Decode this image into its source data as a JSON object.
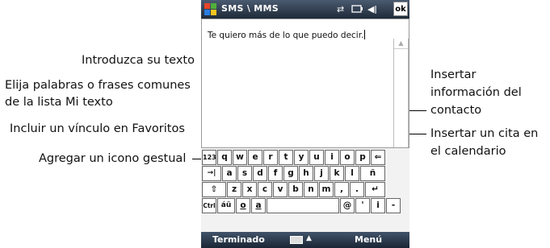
{
  "phone": {
    "title": "SMS \\ MMS",
    "ok_label": "ok",
    "message_text": "Te quiero más de lo que puedo decir.",
    "softkey_left": "Terminado",
    "softkey_right": "Menú",
    "icons": [
      "windows-start-icon",
      "connectivity-icon",
      "battery-icon",
      "volume-icon"
    ],
    "toolbar_icons": [
      "smiley-icon",
      "favorites-star-icon",
      "my-text-icon",
      "contact-card-icon",
      "calendar-icon"
    ],
    "keyboard": {
      "rows": [
        [
          "123",
          "q",
          "w",
          "e",
          "r",
          "t",
          "y",
          "u",
          "i",
          "o",
          "p",
          "⇐"
        ],
        [
          "→|",
          "a",
          "s",
          "d",
          "f",
          "g",
          "h",
          "j",
          "k",
          "l",
          "ñ"
        ],
        [
          "⇧",
          "z",
          "x",
          "c",
          "v",
          "b",
          "n",
          "m",
          ",",
          ".",
          "↵"
        ],
        [
          "Ctrl",
          "áü",
          "o",
          "a",
          "",
          "@",
          "'",
          "i",
          "-"
        ]
      ]
    }
  },
  "callouts": {
    "introduzca": "Introduzca su texto",
    "elija_1": "Elija palabras o frases comunes",
    "elija_2": "de la lista Mi texto",
    "incluir": "Incluir un vínculo en Favoritos",
    "agregar": "Agregar un icono gestual",
    "insertar_info_1": "Insertar",
    "insertar_info_2": "información del",
    "insertar_info_3": "contacto",
    "insertar_cita_1": "Insertar un cita en",
    "insertar_cita_2": "el calendario"
  }
}
